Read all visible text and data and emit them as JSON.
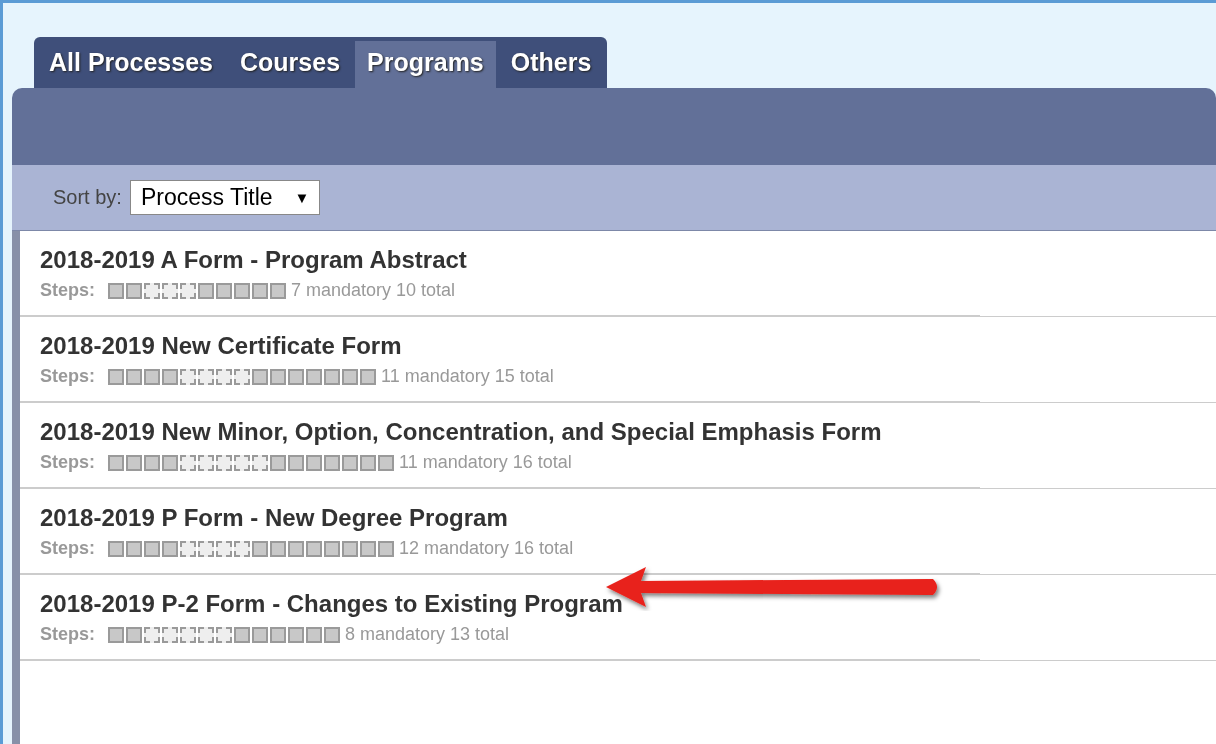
{
  "tabs": [
    {
      "label": "All Processes",
      "selected": false
    },
    {
      "label": "Courses",
      "selected": false
    },
    {
      "label": "Programs",
      "selected": true
    },
    {
      "label": "Others",
      "selected": false
    }
  ],
  "sort": {
    "label": "Sort by:",
    "value": "Process Title",
    "caret": "▼"
  },
  "processes": [
    {
      "title": "2018-2019 A Form - Program Abstract",
      "steps_label": "Steps:",
      "summary": "7 mandatory 10 total",
      "steps": [
        {
          "mandatory": true
        },
        {
          "mandatory": true
        },
        {
          "mandatory": false
        },
        {
          "mandatory": false
        },
        {
          "mandatory": false
        },
        {
          "mandatory": true
        },
        {
          "mandatory": true
        },
        {
          "mandatory": true
        },
        {
          "mandatory": true
        },
        {
          "mandatory": true
        }
      ]
    },
    {
      "title": "2018-2019 New Certificate Form",
      "steps_label": "Steps:",
      "summary": "11 mandatory 15 total",
      "steps": [
        {
          "mandatory": true
        },
        {
          "mandatory": true
        },
        {
          "mandatory": true
        },
        {
          "mandatory": true
        },
        {
          "mandatory": false
        },
        {
          "mandatory": false
        },
        {
          "mandatory": false
        },
        {
          "mandatory": false
        },
        {
          "mandatory": true
        },
        {
          "mandatory": true
        },
        {
          "mandatory": true
        },
        {
          "mandatory": true
        },
        {
          "mandatory": true
        },
        {
          "mandatory": true
        },
        {
          "mandatory": true
        }
      ]
    },
    {
      "title": "2018-2019 New Minor, Option, Concentration, and Special Emphasis Form",
      "steps_label": "Steps:",
      "summary": "11 mandatory 16 total",
      "steps": [
        {
          "mandatory": true
        },
        {
          "mandatory": true
        },
        {
          "mandatory": true
        },
        {
          "mandatory": true
        },
        {
          "mandatory": false
        },
        {
          "mandatory": false
        },
        {
          "mandatory": false
        },
        {
          "mandatory": false
        },
        {
          "mandatory": false
        },
        {
          "mandatory": true
        },
        {
          "mandatory": true
        },
        {
          "mandatory": true
        },
        {
          "mandatory": true
        },
        {
          "mandatory": true
        },
        {
          "mandatory": true
        },
        {
          "mandatory": true
        }
      ]
    },
    {
      "title": "2018-2019 P Form - New Degree Program",
      "steps_label": "Steps:",
      "summary": "12 mandatory 16 total",
      "steps": [
        {
          "mandatory": true
        },
        {
          "mandatory": true
        },
        {
          "mandatory": true
        },
        {
          "mandatory": true
        },
        {
          "mandatory": false
        },
        {
          "mandatory": false
        },
        {
          "mandatory": false
        },
        {
          "mandatory": false
        },
        {
          "mandatory": true
        },
        {
          "mandatory": true
        },
        {
          "mandatory": true
        },
        {
          "mandatory": true
        },
        {
          "mandatory": true
        },
        {
          "mandatory": true
        },
        {
          "mandatory": true
        },
        {
          "mandatory": true
        }
      ]
    },
    {
      "title": "2018-2019 P-2 Form - Changes to Existing Program",
      "steps_label": "Steps:",
      "summary": "8 mandatory 13 total",
      "steps": [
        {
          "mandatory": true
        },
        {
          "mandatory": true
        },
        {
          "mandatory": false
        },
        {
          "mandatory": false
        },
        {
          "mandatory": false
        },
        {
          "mandatory": false
        },
        {
          "mandatory": false
        },
        {
          "mandatory": true
        },
        {
          "mandatory": true
        },
        {
          "mandatory": true
        },
        {
          "mandatory": true
        },
        {
          "mandatory": true
        },
        {
          "mandatory": true
        }
      ]
    }
  ]
}
